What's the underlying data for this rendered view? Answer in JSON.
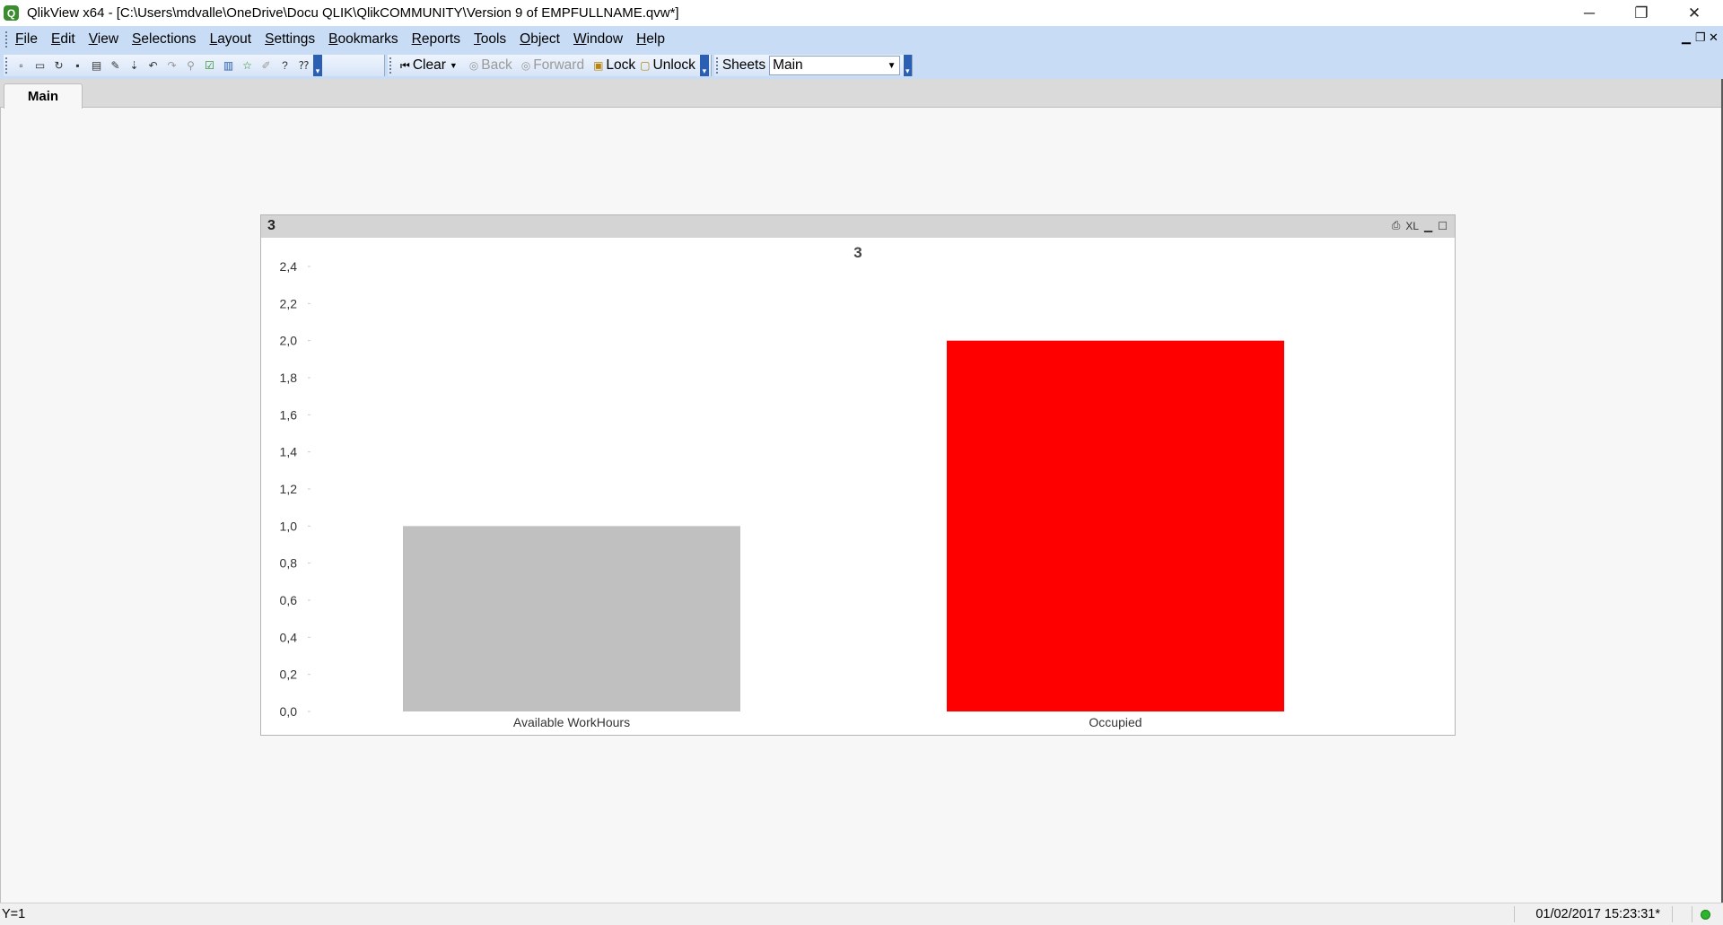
{
  "window": {
    "title": "QlikView x64 - [C:\\Users\\mdvalle\\OneDrive\\Docu QLIK\\QlikCOMMUNITY\\Version  9 of EMPFULLNAME.qvw*]",
    "app_icon_letter": "Q",
    "minimize": "─",
    "restore": "❐",
    "close": "✕"
  },
  "menu": {
    "items": [
      {
        "u": "F",
        "rest": "ile"
      },
      {
        "u": "E",
        "rest": "dit"
      },
      {
        "u": "V",
        "rest": "iew"
      },
      {
        "u": "S",
        "rest": "elections"
      },
      {
        "u": "L",
        "rest": "ayout"
      },
      {
        "u": "S",
        "rest": "ettings"
      },
      {
        "u": "B",
        "rest": "ookmarks"
      },
      {
        "u": "R",
        "rest": "eports"
      },
      {
        "u": "T",
        "rest": "ools"
      },
      {
        "u": "O",
        "rest": "bject"
      },
      {
        "u": "W",
        "rest": "indow"
      },
      {
        "u": "H",
        "rest": "elp"
      }
    ],
    "mdi_minimize": "▁",
    "mdi_restore": "❐",
    "mdi_close": "✕"
  },
  "toolbar": {
    "clear_label": "Clear",
    "back_label": "Back",
    "forward_label": "Forward",
    "lock_label": "Lock",
    "unlock_label": "Unlock",
    "sheets_label": "Sheets",
    "sheets_selected": "Main"
  },
  "tabs": [
    {
      "label": "Main",
      "active": true
    }
  ],
  "chart_object": {
    "caption": "3",
    "icons": [
      "print-icon",
      "xl-export-icon",
      "minimize-icon",
      "maximize-icon"
    ],
    "xl_label": "XL"
  },
  "chart_data": {
    "type": "bar",
    "title": "3",
    "categories": [
      "Available WorkHours",
      "Occupied"
    ],
    "values": [
      1.0,
      2.0
    ],
    "colors": [
      "#c0c0c0",
      "#ff0000"
    ],
    "ylim": [
      0,
      2.4
    ],
    "yticks": [
      "0,0",
      "0,2",
      "0,4",
      "0,6",
      "0,8",
      "1,0",
      "1,2",
      "1,4",
      "1,6",
      "1,8",
      "2,0",
      "2,2",
      "2,4"
    ],
    "xlabel": "",
    "ylabel": "",
    "grid": false,
    "legend": "none"
  },
  "statusbar": {
    "left": "Y=1",
    "right": "01/02/2017 15:23:31*"
  }
}
